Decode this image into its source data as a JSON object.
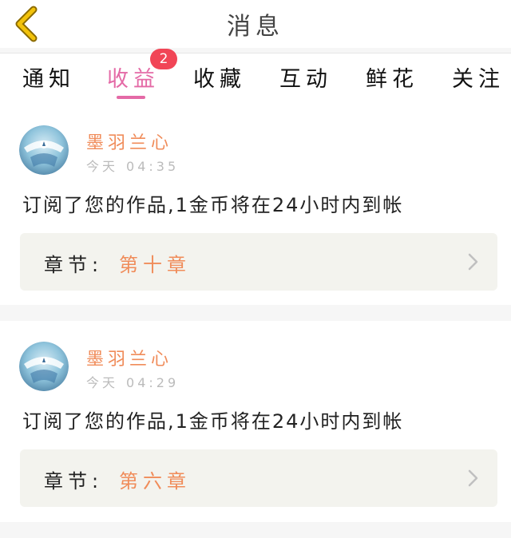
{
  "header": {
    "title": "消息",
    "back_icon": "chevron-left-icon",
    "back_color": "#f2c20a"
  },
  "tabs": [
    {
      "label": "通知",
      "active": false
    },
    {
      "label": "收益",
      "active": true,
      "badge": "2"
    },
    {
      "label": "收藏",
      "active": false
    },
    {
      "label": "互动",
      "active": false
    },
    {
      "label": "鲜花",
      "active": false
    },
    {
      "label": "关注",
      "active": false
    }
  ],
  "colors": {
    "accent": "#e46aa6",
    "badge": "#f14556",
    "author": "#f08c5a",
    "chapter_value": "#f08c5a"
  },
  "messages": [
    {
      "author": "墨羽兰心",
      "day": "今天",
      "time": "04:35",
      "text": "订阅了您的作品,1金币将在24小时内到帐",
      "chapter_label": "章节:",
      "chapter_value": "第十章"
    },
    {
      "author": "墨羽兰心",
      "day": "今天",
      "time": "04:29",
      "text": "订阅了您的作品,1金币将在24小时内到帐",
      "chapter_label": "章节:",
      "chapter_value": "第六章"
    }
  ]
}
